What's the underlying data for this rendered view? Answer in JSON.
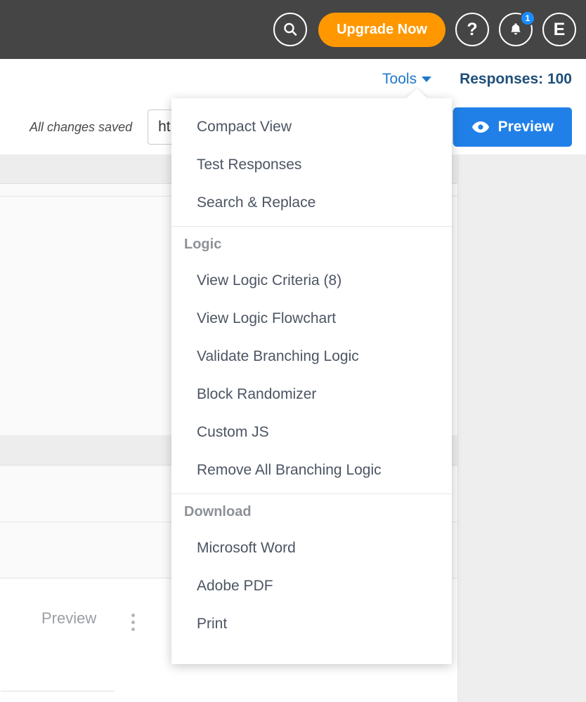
{
  "topbar": {
    "search_icon": "search-icon",
    "upgrade_label": "Upgrade Now",
    "help_glyph": "?",
    "notifications_icon": "bell-icon",
    "notification_count": "1",
    "avatar_initial": "E",
    "background_color": "#454545",
    "upgrade_color": "#ff9800",
    "badge_color": "#1a8cff"
  },
  "subheader": {
    "tools_label": "Tools",
    "tools_color": "#2077c8",
    "responses_label": "Responses: 100",
    "responses_color": "#1f4e79"
  },
  "actionbar": {
    "saved_status": "All changes saved",
    "url_value": "ht",
    "url_placeholder": "https://",
    "preview_label": "Preview",
    "preview_color": "#2080e8",
    "preview_icon": "eye-icon"
  },
  "canvas": {
    "preview_ghost_label": "Preview",
    "kebab_icon": "kebab-menu-icon"
  },
  "menu": {
    "sections": [
      {
        "title": null,
        "items": [
          {
            "label": "Compact View"
          },
          {
            "label": "Test Responses"
          },
          {
            "label": "Search & Replace"
          }
        ]
      },
      {
        "title": "Logic",
        "items": [
          {
            "label": "View Logic Criteria (8)"
          },
          {
            "label": "View Logic Flowchart"
          },
          {
            "label": "Validate Branching Logic"
          },
          {
            "label": "Block Randomizer"
          },
          {
            "label": "Custom JS"
          },
          {
            "label": "Remove All Branching Logic"
          }
        ]
      },
      {
        "title": "Download",
        "items": [
          {
            "label": "Microsoft Word"
          },
          {
            "label": "Adobe PDF"
          },
          {
            "label": "Print"
          }
        ]
      }
    ]
  }
}
